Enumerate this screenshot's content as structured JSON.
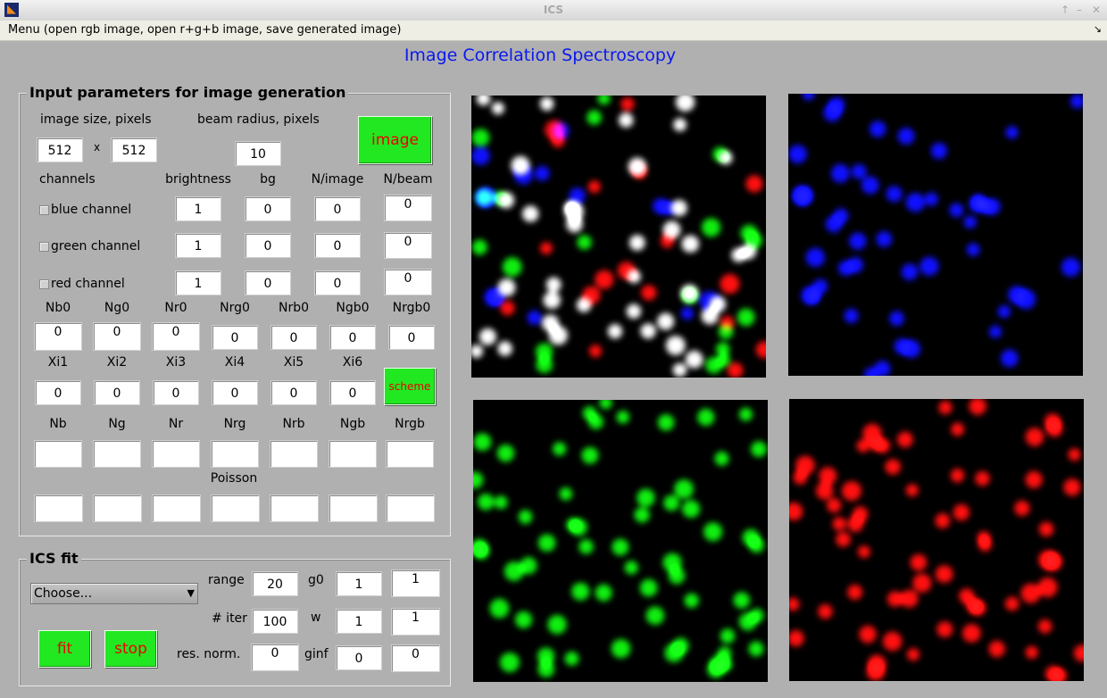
{
  "window": {
    "title": "ICS",
    "icon": "matlab-icon",
    "controls": [
      "↑",
      "–",
      "✕"
    ]
  },
  "menu": {
    "label": "Menu (open rgb image, open r+g+b image, save generated image)",
    "arrow_glyph": "↘"
  },
  "app_title": "Image Correlation Spectroscopy",
  "input_panel": {
    "title": "Input parameters for image generation",
    "image_size_label": "image size, pixels",
    "size_x": "512",
    "size_sep": "x",
    "size_y": "512",
    "beam_radius_label": "beam radius, pixels",
    "beam_radius": "10",
    "image_button": "image",
    "headers": {
      "channels": "channels",
      "brightness": "brightness",
      "bg": "bg",
      "n_image": "N/image",
      "n_beam": "N/beam"
    },
    "channels": [
      {
        "label": "blue channel",
        "brightness": "1",
        "bg": "0",
        "n_image": "0",
        "n_beam": "0"
      },
      {
        "label": "green channel",
        "brightness": "1",
        "bg": "0",
        "n_image": "0",
        "n_beam": "0"
      },
      {
        "label": "red channel",
        "brightness": "1",
        "bg": "0",
        "n_image": "0",
        "n_beam": "0"
      }
    ],
    "n0_labels": [
      "Nb0",
      "Ng0",
      "Nr0",
      "Nrg0",
      "Nrb0",
      "Ngb0",
      "Nrgb0"
    ],
    "n0_values": [
      "0",
      "0",
      "0",
      "0",
      "0",
      "0",
      "0"
    ],
    "xi_labels": [
      "Xi1",
      "Xi2",
      "Xi3",
      "Xi4",
      "Xi5",
      "Xi6"
    ],
    "xi_values": [
      "0",
      "0",
      "0",
      "0",
      "0",
      "0"
    ],
    "scheme_button": "scheme",
    "n_labels": [
      "Nb",
      "Ng",
      "Nr",
      "Nrg",
      "Nrb",
      "Ngb",
      "Nrgb"
    ],
    "n_values": [
      "",
      "",
      "",
      "",
      "",
      "",
      ""
    ],
    "poisson_label": "Poisson",
    "poisson_values": [
      "",
      "",
      "",
      "",
      "",
      "",
      ""
    ]
  },
  "fit_panel": {
    "title": "ICS fit",
    "select_value": "Choose...",
    "range_label": "range",
    "range": "20",
    "iter_label": "# iter",
    "iter": "100",
    "resnorm_label": "res. norm.",
    "resnorm": "0",
    "g0_label": "g0",
    "g0": "1",
    "g0_result": "1",
    "w_label": "w",
    "w": "1",
    "w_result": "1",
    "ginf_label": "ginf",
    "ginf": "0",
    "ginf_result": "0",
    "fit_button": "fit",
    "stop_button": "stop"
  },
  "colors": {
    "accent_title": "#0a19ee",
    "button_green": "#22e822",
    "button_text": "#e00000",
    "window_bg": "#b0b0b0"
  },
  "image_panels": [
    {
      "name": "rgb-composite-image",
      "channels": "rgb"
    },
    {
      "name": "blue-channel-image",
      "channels": "blue"
    },
    {
      "name": "green-channel-image",
      "channels": "green"
    },
    {
      "name": "red-channel-image",
      "channels": "red"
    }
  ]
}
